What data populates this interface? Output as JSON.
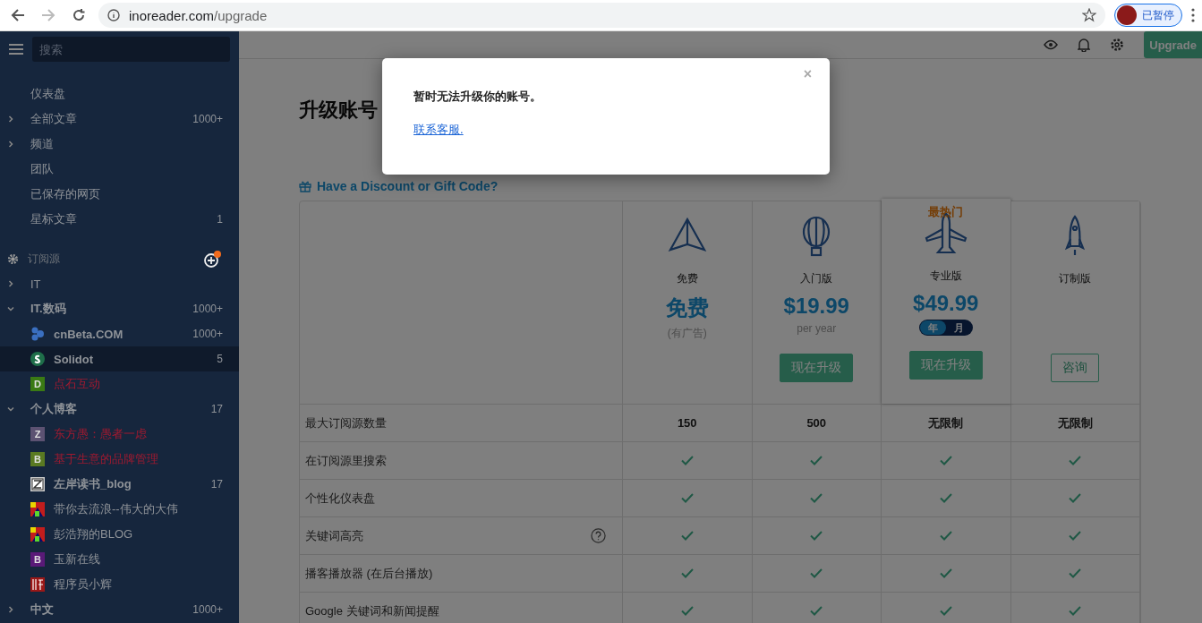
{
  "browser": {
    "url_host": "inoreader.com",
    "url_path": "/upgrade",
    "profile_label": "已暂停"
  },
  "sidebar": {
    "search": {
      "placeholder": "搜索"
    },
    "nav": [
      {
        "label": "仪表盘"
      },
      {
        "label": "全部文章",
        "count": "1000+",
        "expanded": false
      },
      {
        "label": "频道",
        "expanded": false
      },
      {
        "label": "团队"
      },
      {
        "label": "已保存的网页"
      },
      {
        "label": "星标文章",
        "count": "1"
      }
    ],
    "feeds_title": "订阅源",
    "feeds": [
      {
        "label": "IT",
        "expanded": false,
        "bold": false
      },
      {
        "label": "IT.数码",
        "count": "1000+",
        "expanded": true,
        "bold": true,
        "children": [
          {
            "label": "cnBeta.COM",
            "count": "1000+",
            "bold": true,
            "error": false,
            "selected": false,
            "icon": {
              "kind": "dots"
            }
          },
          {
            "label": "Solidot",
            "count": "5",
            "bold": true,
            "error": false,
            "selected": true,
            "icon": {
              "kind": "circle"
            }
          },
          {
            "label": "点石互动",
            "bold": false,
            "error": true,
            "selected": false,
            "icon": {
              "kind": "letter",
              "letter": "D",
              "color": "#3a7a14"
            }
          }
        ]
      },
      {
        "label": "个人博客",
        "count": "17",
        "expanded": true,
        "bold": true,
        "children": [
          {
            "label": "东方愚：愚者一虑",
            "bold": false,
            "error": true,
            "selected": false,
            "icon": {
              "kind": "letter",
              "letter": "Z",
              "color": "#5c5272"
            }
          },
          {
            "label": "基于生意的品牌管理",
            "bold": false,
            "error": true,
            "selected": false,
            "icon": {
              "kind": "letter",
              "letter": "B",
              "color": "#5a7a22"
            }
          },
          {
            "label": "左岸读书_blog",
            "count": "17",
            "bold": true,
            "error": false,
            "selected": false,
            "icon": {
              "kind": "square"
            }
          },
          {
            "label": "带你去流浪--伟大的大伟",
            "bold": false,
            "error": false,
            "selected": false,
            "icon": {
              "kind": "mosaic"
            }
          },
          {
            "label": "彭浩翔的BLOG",
            "bold": false,
            "error": false,
            "selected": false,
            "icon": {
              "kind": "mosaic"
            }
          },
          {
            "label": "玉新在线",
            "bold": false,
            "error": false,
            "selected": false,
            "icon": {
              "kind": "letter",
              "letter": "B",
              "color": "#5a1a78"
            }
          },
          {
            "label": "程序员小辉",
            "bold": false,
            "error": false,
            "selected": false,
            "icon": {
              "kind": "seal"
            }
          }
        ]
      },
      {
        "label": "中文",
        "count": "1000+",
        "expanded": false,
        "bold": true
      }
    ]
  },
  "topbar": {
    "upgrade_label": "Upgrade"
  },
  "main": {
    "title": "升级账号",
    "discount_link": "Have a Discount or Gift Code?",
    "plans": [
      {
        "kind": "plane",
        "name": "免费",
        "price": "免费",
        "note": "(有广告)",
        "popular": false
      },
      {
        "kind": "balloon",
        "name": "入门版",
        "price": "$19.99",
        "note": "per year",
        "popular": false,
        "button": {
          "kind": "filled",
          "label": "现在升级"
        }
      },
      {
        "kind": "jet",
        "name": "专业版",
        "price": "$49.99",
        "popular": true,
        "popular_label": "最热门",
        "toggle": [
          {
            "label": "年",
            "selected": true
          },
          {
            "label": "月",
            "selected": false
          }
        ],
        "button": {
          "kind": "filled",
          "label": "现在升级"
        }
      },
      {
        "kind": "rocket",
        "name": "订制版",
        "popular": false,
        "button": {
          "kind": "outline",
          "label": "咨询"
        }
      }
    ],
    "features": [
      {
        "label": "最大订阅源数量",
        "help": false,
        "values": [
          {
            "kind": "text",
            "text": "150"
          },
          {
            "kind": "text",
            "text": "500"
          },
          {
            "kind": "text",
            "text": "无限制"
          },
          {
            "kind": "text",
            "text": "无限制"
          }
        ]
      },
      {
        "label": "在订阅源里搜索",
        "help": false,
        "values": [
          {
            "kind": "check"
          },
          {
            "kind": "check"
          },
          {
            "kind": "check"
          },
          {
            "kind": "check"
          }
        ]
      },
      {
        "label": "个性化仪表盘",
        "help": false,
        "values": [
          {
            "kind": "check"
          },
          {
            "kind": "check"
          },
          {
            "kind": "check"
          },
          {
            "kind": "check"
          }
        ]
      },
      {
        "label": "关键词高亮",
        "help": true,
        "values": [
          {
            "kind": "check"
          },
          {
            "kind": "check"
          },
          {
            "kind": "check"
          },
          {
            "kind": "check"
          }
        ]
      },
      {
        "label": "播客播放器 (在后台播放)",
        "help": false,
        "values": [
          {
            "kind": "check"
          },
          {
            "kind": "check"
          },
          {
            "kind": "check"
          },
          {
            "kind": "check"
          }
        ]
      },
      {
        "label": "Google 关键词和新闻提醒",
        "help": false,
        "values": [
          {
            "kind": "check"
          },
          {
            "kind": "check"
          },
          {
            "kind": "check"
          },
          {
            "kind": "check"
          }
        ]
      }
    ]
  },
  "dialog": {
    "message": "暂时无法升级你的账号。",
    "link": "联系客服.",
    "close": "×"
  }
}
